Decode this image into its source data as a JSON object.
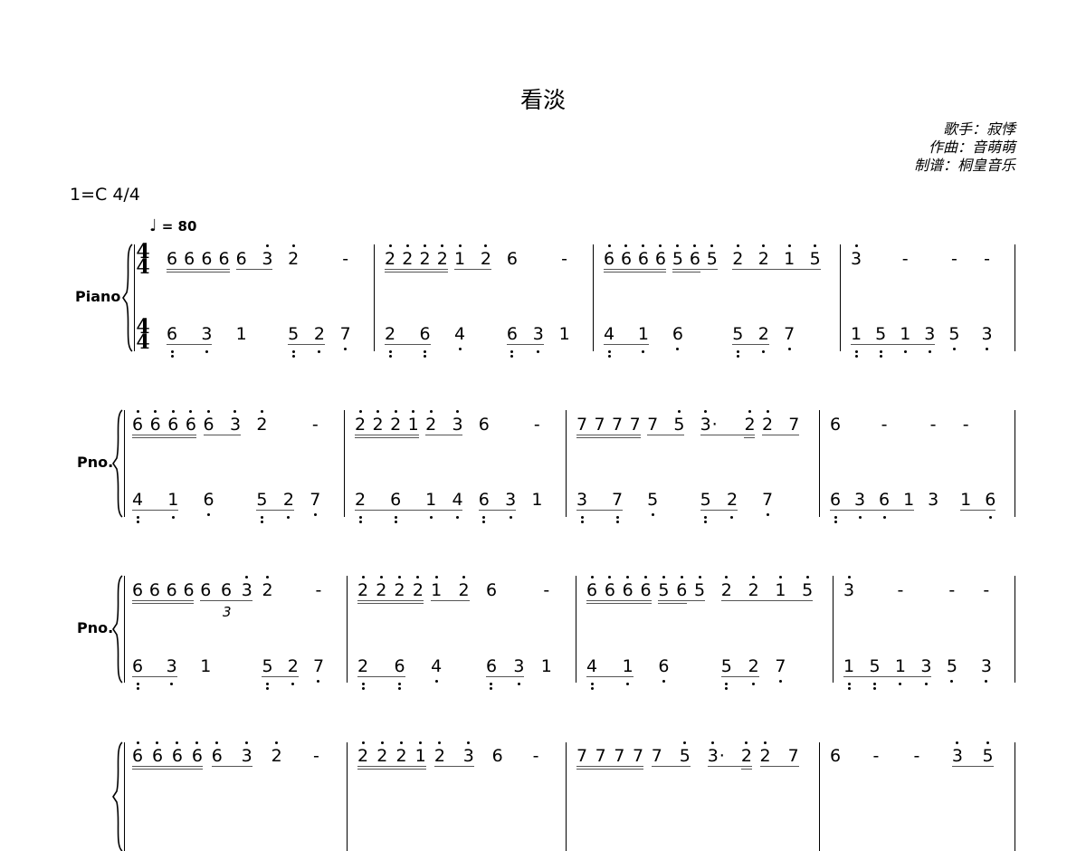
{
  "title": "看淡",
  "credits": [
    "歌手：寂悸",
    "作曲：音萌萌",
    "制谱：桐皇音乐"
  ],
  "key_signature": "1=C 4/4",
  "tempo": {
    "note_icon": "quarter-note-icon",
    "text": "= 80"
  },
  "time_signature": {
    "top": "4",
    "bottom": "4"
  },
  "notation_key": "digit, ' = octave up dot, , = octave down dot, . = augmentation dot, _ = underline, t = triplet",
  "tuplet_label": "3",
  "systems": [
    {
      "label": "Piano",
      "measures": [
        {
          "upper": [
            [
              "6__",
              "6__",
              "6__",
              "6__"
            ],
            [
              "6_",
              "3'_"
            ],
            [
              "2'"
            ],
            [
              "-"
            ]
          ],
          "lower": [
            [
              "6,,_",
              "3,_"
            ],
            [
              "1"
            ],
            [
              "5,,_",
              "2,_"
            ],
            [
              "7,"
            ]
          ]
        },
        {
          "upper": [
            [
              "2'__",
              "2'__",
              "2'__",
              "2'__"
            ],
            [
              "1'_",
              "2'_"
            ],
            [
              "6"
            ],
            [
              "-"
            ]
          ],
          "lower": [
            [
              "2,,_",
              "6,,_"
            ],
            [
              "4,"
            ],
            [
              "6,,_",
              "3,_"
            ],
            [
              "1"
            ]
          ]
        },
        {
          "upper": [
            [
              "6'__",
              "6'__",
              "6'__",
              "6'__"
            ],
            [
              "5'__",
              "6'__",
              "5'_"
            ],
            [
              "2'_",
              "2'_",
              "1'_",
              "5'_"
            ]
          ],
          "lower": [
            [
              "4,,_",
              "1,_"
            ],
            [
              "6,"
            ],
            [
              "5,,_",
              "2,_"
            ],
            [
              "7,"
            ]
          ]
        },
        {
          "upper": [
            [
              "3'"
            ],
            [
              "-"
            ],
            [
              "-"
            ],
            [
              "-"
            ]
          ],
          "lower": [
            [
              "1,,_",
              "5,,_",
              "1,_",
              "3,_"
            ],
            [
              "5,"
            ],
            [
              "3,"
            ]
          ]
        }
      ]
    },
    {
      "label": "Pno.",
      "measures": [
        {
          "upper": [
            [
              "6'__",
              "6'__",
              "6'__",
              "6'__"
            ],
            [
              "6'_",
              "3'_"
            ],
            [
              "2'"
            ],
            [
              "-"
            ]
          ],
          "lower": [
            [
              "4,,_",
              "1,_"
            ],
            [
              "6,"
            ],
            [
              "5,,_",
              "2,_"
            ],
            [
              "7,"
            ]
          ]
        },
        {
          "upper": [
            [
              "2'__",
              "2'__",
              "2'__",
              "1'__"
            ],
            [
              "2'_",
              "3'_"
            ],
            [
              "6"
            ],
            [
              "-"
            ]
          ],
          "lower": [
            [
              "2,,_",
              "6,,_",
              "1,_",
              "4,_"
            ],
            [
              "6,,_",
              "3,_"
            ],
            [
              "1"
            ]
          ]
        },
        {
          "upper": [
            [
              "7__",
              "7__",
              "7__",
              "7__"
            ],
            [
              "7_",
              "5'_"
            ],
            [
              "3'._",
              "2'__"
            ],
            [
              "2'_",
              "7_"
            ]
          ],
          "lower": [
            [
              "3,,_",
              "7,,_"
            ],
            [
              "5,"
            ],
            [
              "5,,_",
              "2,_"
            ],
            [
              "7,"
            ]
          ]
        },
        {
          "upper": [
            [
              "6"
            ],
            [
              "-"
            ],
            [
              "-"
            ],
            [
              "-"
            ]
          ],
          "lower": [
            [
              "6,,_",
              "3,_",
              "6,_",
              "1_"
            ],
            [
              "3"
            ],
            [
              "1_",
              "6,_"
            ]
          ]
        }
      ]
    },
    {
      "label": "Pno.",
      "measures": [
        {
          "upper": [
            [
              "6__",
              "6__",
              "6__",
              "6__"
            ],
            [
              "6_t",
              "6_t",
              "3'_t"
            ],
            [
              "2'"
            ],
            [
              "-"
            ]
          ],
          "lower": [
            [
              "6,,_",
              "3,_"
            ],
            [
              "1"
            ],
            [
              "5,,_",
              "2,_"
            ],
            [
              "7,"
            ]
          ]
        },
        {
          "upper": [
            [
              "2'__",
              "2'__",
              "2'__",
              "2'__"
            ],
            [
              "1'_",
              "2'_"
            ],
            [
              "6"
            ],
            [
              "-"
            ]
          ],
          "lower": [
            [
              "2,,_",
              "6,,_"
            ],
            [
              "4,"
            ],
            [
              "6,,_",
              "3,_"
            ],
            [
              "1"
            ]
          ]
        },
        {
          "upper": [
            [
              "6'__",
              "6'__",
              "6'__",
              "6'__"
            ],
            [
              "5'__",
              "6'__",
              "5'_"
            ],
            [
              "2'_",
              "2'_",
              "1'_",
              "5'_"
            ]
          ],
          "lower": [
            [
              "4,,_",
              "1,_"
            ],
            [
              "6,"
            ],
            [
              "5,,_",
              "2,_"
            ],
            [
              "7,"
            ]
          ]
        },
        {
          "upper": [
            [
              "3'"
            ],
            [
              "-"
            ],
            [
              "-"
            ],
            [
              "-"
            ]
          ],
          "lower": [
            [
              "1,,_",
              "5,,_",
              "1,_",
              "3,_"
            ],
            [
              "5,"
            ],
            [
              "3,"
            ]
          ]
        }
      ]
    },
    {
      "label": "",
      "measures": [
        {
          "upper": [
            [
              "6'__",
              "6'__",
              "6'__",
              "6'__"
            ],
            [
              "6'_",
              "3'_"
            ],
            [
              "2'"
            ],
            [
              "-"
            ]
          ]
        },
        {
          "upper": [
            [
              "2'__",
              "2'__",
              "2'__",
              "1'__"
            ],
            [
              "2'_",
              "3'_"
            ],
            [
              "6"
            ],
            [
              "-"
            ]
          ]
        },
        {
          "upper": [
            [
              "7__",
              "7__",
              "7__",
              "7__"
            ],
            [
              "7_",
              "5'_"
            ],
            [
              "3'._",
              "2'__"
            ],
            [
              "2'_",
              "7_"
            ]
          ]
        },
        {
          "upper": [
            [
              "6"
            ],
            [
              "-"
            ],
            [
              "-"
            ],
            [
              "3'_",
              "5'_"
            ]
          ]
        }
      ]
    }
  ]
}
